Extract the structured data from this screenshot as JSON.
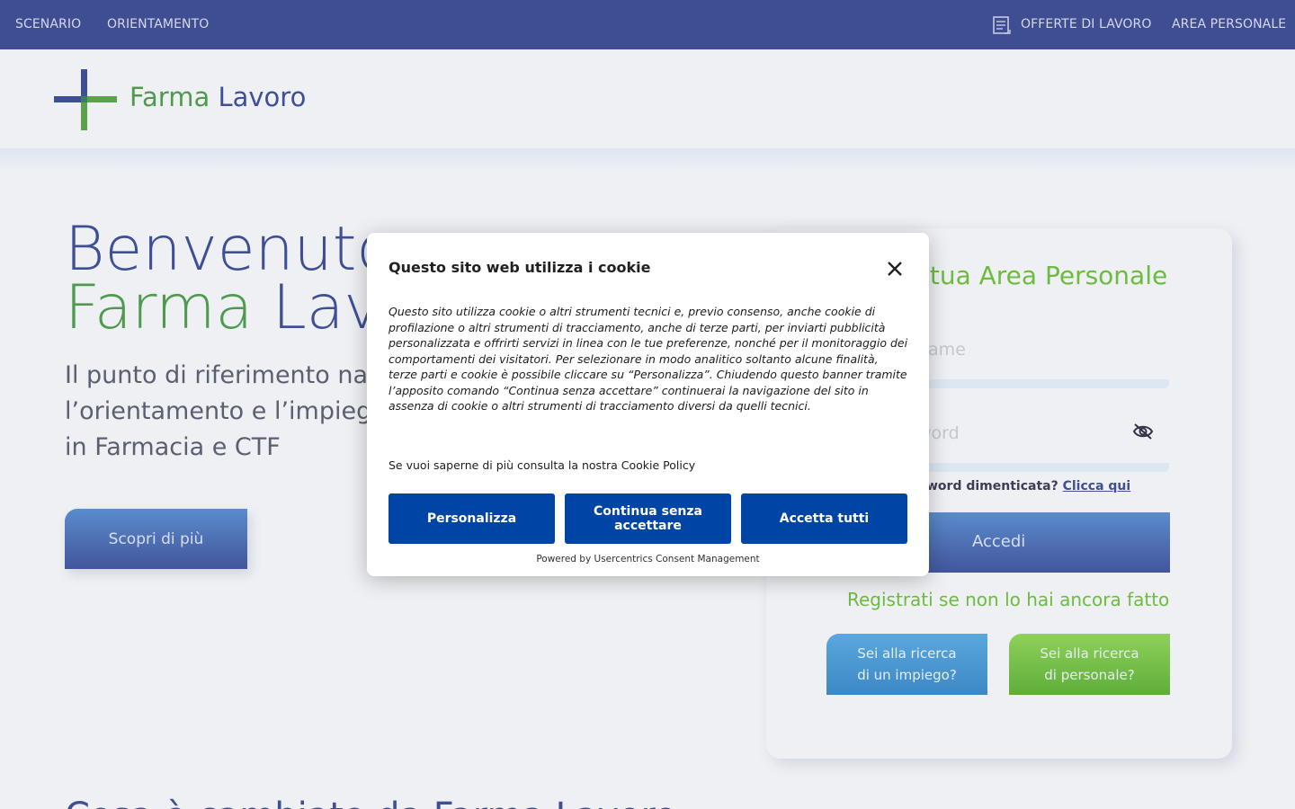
{
  "topnav": {
    "items_left": [
      "SCENARIO",
      "ORIENTAMENTO"
    ],
    "items_right": [
      "OFFERTE DI LAVORO",
      "AREA PERSONALE"
    ],
    "offerte_icon": "document-icon"
  },
  "logo": {
    "farma": "Farma",
    "lavoro": "Lavoro"
  },
  "hero": {
    "title_line1": "Benvenuto",
    "title_farma": "Farma",
    "title_lavoro": "Lavo",
    "subtitle_line1": "Il punto di riferimento nazio",
    "subtitle_line2": "l’orientamento e l’impiego c",
    "subtitle_line3": "in Farmacia e CTF",
    "cta": "Scopri di più"
  },
  "login": {
    "title": "la tua Area Personale",
    "username_placeholder": "name",
    "password_placeholder": "word",
    "forgot_text": "word dimenticata?",
    "forgot_link": "Clicca qui",
    "submit": "Accedi",
    "register": "Registrati se non lo hai ancora fatto",
    "job_seeker": "Sei alla ricerca di un impiego?",
    "job_seeker_l1": "Sei alla ricerca",
    "job_seeker_l2": "di un impiego?",
    "employer_l1": "Sei alla ricerca",
    "employer_l2": "di personale?"
  },
  "bottom": {
    "heading": "Cosa è cambiato da Farma Lavoro"
  },
  "cookie": {
    "title": "Questo sito web utilizza i cookie",
    "body": "Questo sito utilizza cookie o altri strumenti tecnici e, previo consenso, anche cookie di profilazione o altri strumenti di tracciamento, anche di terze parti, per inviarti pubblicità personalizzata e offrirti servizi in linea con le tue preferenze, nonché per il monitoraggio dei comportamenti dei visitatori. Per selezionare in modo analitico soltanto alcune finalità, terze parti e cookie è possibile cliccare su “Personalizza”. Chiudendo questo banner tramite l’apposito comando “Continua senza accettare” continuerai la navigazione del sito in assenza di cookie o altri strumenti di tracciamento diversi da quelli tecnici.",
    "policy": "Se vuoi saperne di più consulta la nostra Cookie Policy",
    "btn_customize": "Personalizza",
    "btn_continue": "Continua senza accettare",
    "btn_accept": "Accetta tutti",
    "footer": "Powered by Usercentrics Consent Management"
  },
  "colors": {
    "nav_bg": "#3f4d93",
    "brand_green": "#4f9a4f",
    "brand_blue": "#3e4f96",
    "accent_green": "#6dbb3f",
    "modal_button": "#0045a5"
  }
}
